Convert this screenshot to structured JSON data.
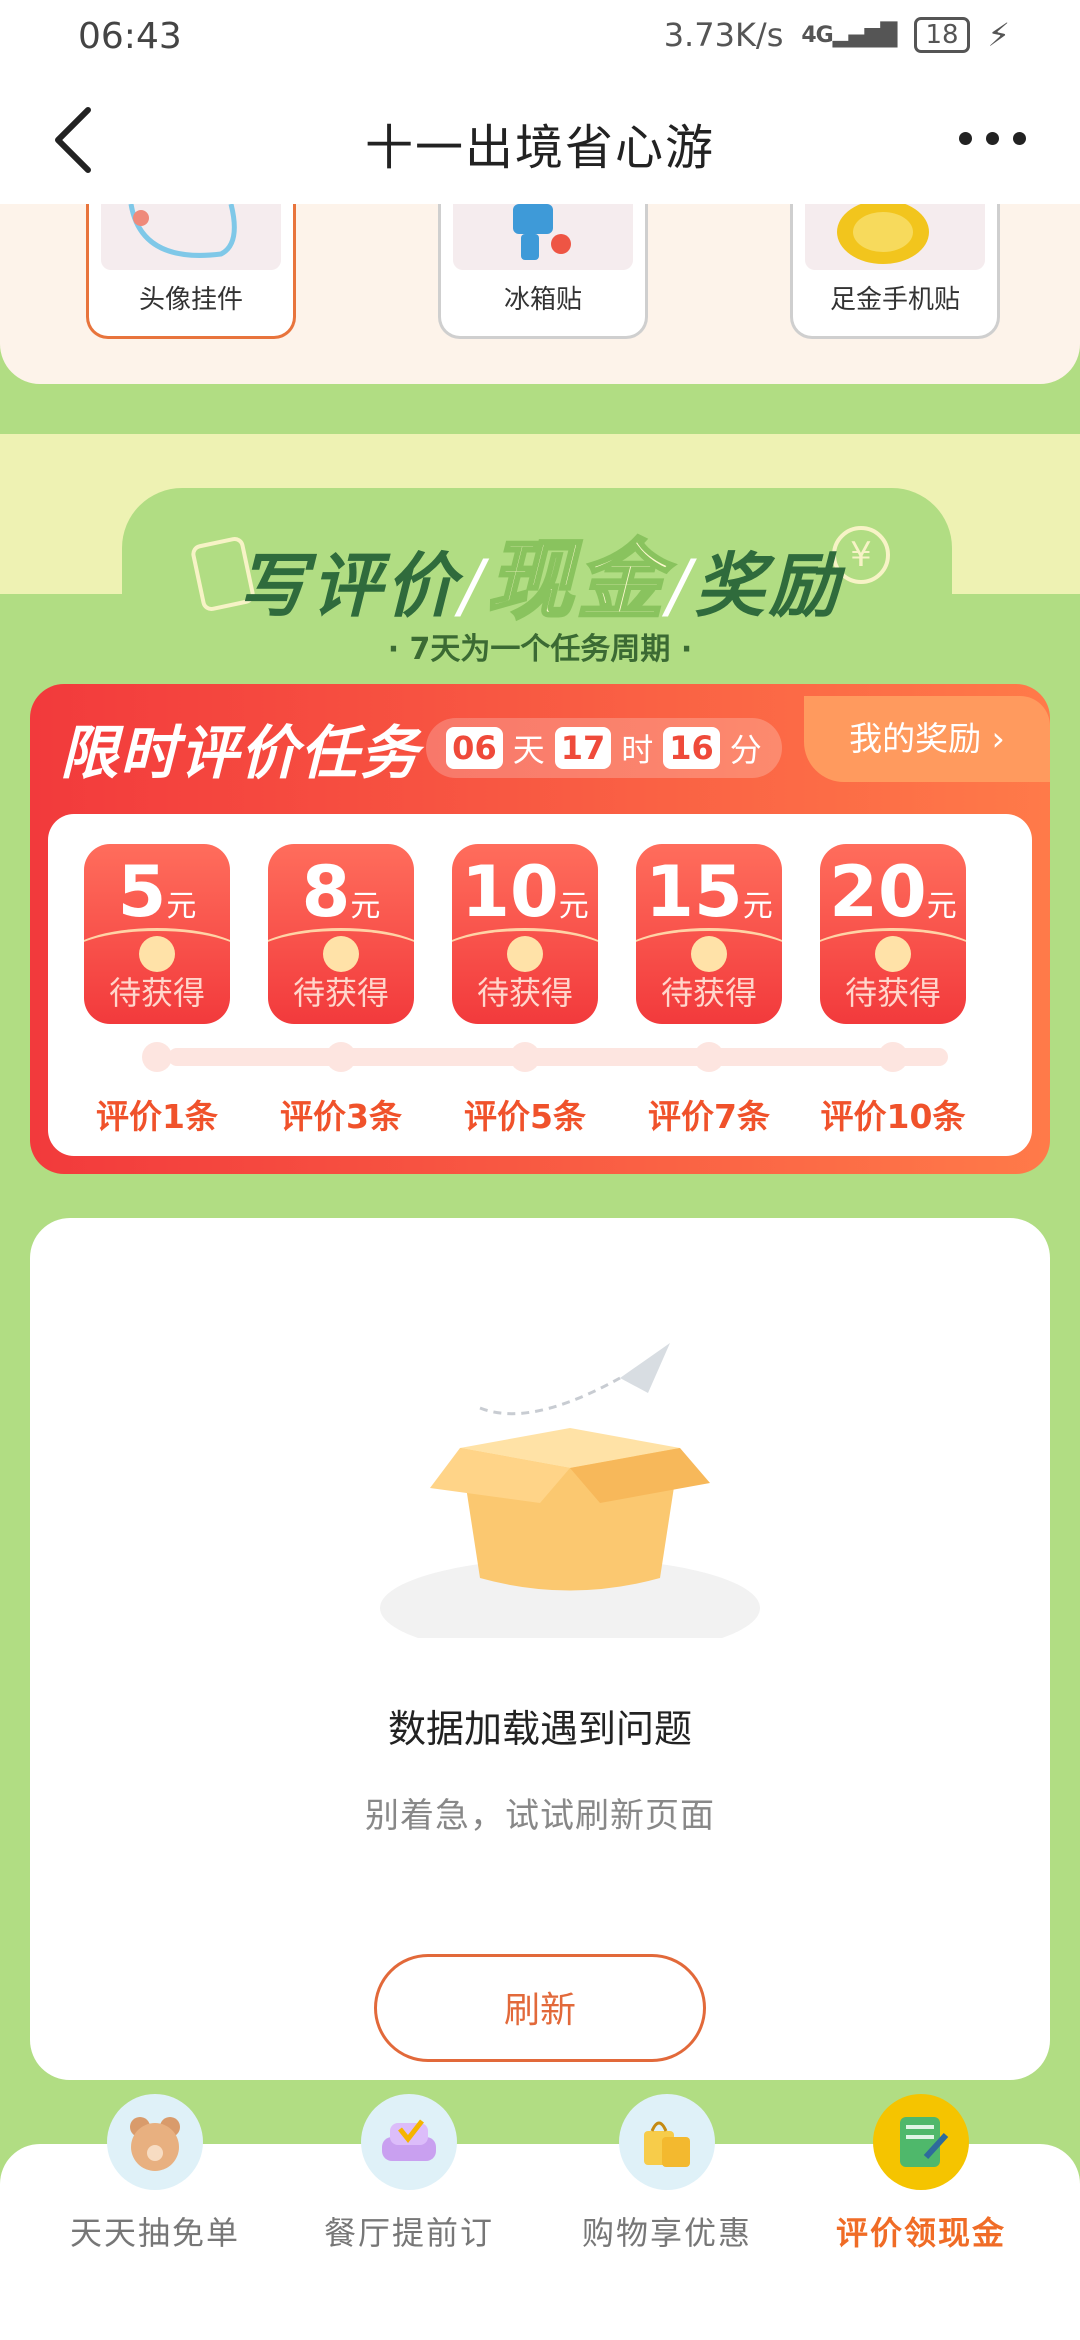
{
  "status": {
    "time": "06:43",
    "speed": "3.73K/s",
    "network": "4G",
    "battery": "18"
  },
  "header": {
    "title": "十一出境省心游"
  },
  "prizes": [
    {
      "label": "头像挂件",
      "selected": true
    },
    {
      "label": "冰箱贴",
      "selected": false
    },
    {
      "label": "足金手机贴",
      "selected": false
    }
  ],
  "banner": {
    "title_part1": "写评价",
    "title_cash": "现金",
    "title_part2": "奖励",
    "subtitle": "· 7天为一个任务周期 ·"
  },
  "task": {
    "title": "限时评价任务",
    "timer": {
      "days": "06",
      "days_unit": "天",
      "hours": "17",
      "hours_unit": "时",
      "minutes": "16",
      "minutes_unit": "分"
    },
    "my_reward": "我的奖励 ›",
    "rewards": [
      {
        "amount": "5",
        "unit": "元",
        "status": "待获得",
        "requirement": "评价1条"
      },
      {
        "amount": "8",
        "unit": "元",
        "status": "待获得",
        "requirement": "评价3条"
      },
      {
        "amount": "10",
        "unit": "元",
        "status": "待获得",
        "requirement": "评价5条"
      },
      {
        "amount": "15",
        "unit": "元",
        "status": "待获得",
        "requirement": "评价7条"
      },
      {
        "amount": "20",
        "unit": "元",
        "status": "待获得",
        "requirement": "评价10条"
      }
    ]
  },
  "error": {
    "title": "数据加载遇到问题",
    "subtitle": "别着急，试试刷新页面",
    "button": "刷新"
  },
  "bottom_tabs": [
    {
      "label": "天天抽免单",
      "icon": "bear-icon",
      "active": false
    },
    {
      "label": "餐厅提前订",
      "icon": "sofa-icon",
      "active": false
    },
    {
      "label": "购物享优惠",
      "icon": "shopping-bag-icon",
      "active": false
    },
    {
      "label": "评价领现金",
      "icon": "notepad-icon",
      "active": true
    }
  ],
  "colors": {
    "accent": "#f06c26",
    "page_green": "#b1dd83",
    "task_red": "#f23a3c"
  }
}
